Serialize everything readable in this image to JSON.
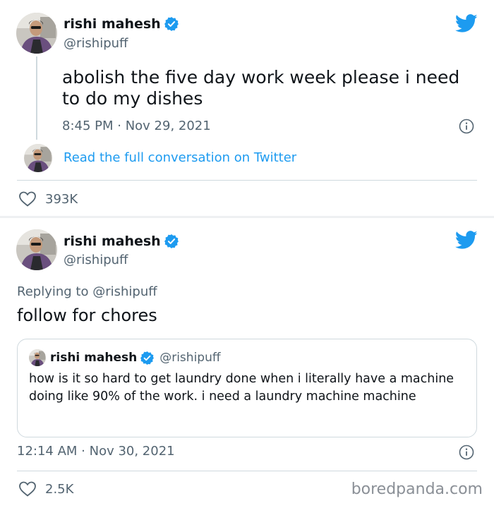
{
  "tweet1": {
    "author": {
      "name": "rishi mahesh",
      "handle": "@rishipuff"
    },
    "text": "abolish the five day work week please i need to do my dishes",
    "timestamp": "8:45 PM · Nov 29, 2021",
    "read_full": "Read the full conversation on Twitter",
    "likes": "393K"
  },
  "tweet2": {
    "author": {
      "name": "rishi mahesh",
      "handle": "@rishipuff"
    },
    "replying_to": "Replying to @rishipuff",
    "text": "follow for chores",
    "quote": {
      "name": "rishi mahesh",
      "handle": "@rishipuff",
      "text": "how is it so hard to get laundry done when i literally have a machine doing like 90% of the work. i need a laundry machine machine"
    },
    "timestamp": "12:14 AM · Nov 30, 2021",
    "likes": "2.5K"
  },
  "watermark": "boredpanda.com",
  "colors": {
    "twitter_blue": "#1d9bf0",
    "secondary_text": "#536471",
    "border": "#cfd9de"
  },
  "icons": [
    "twitter-bird-icon",
    "verified-badge-icon",
    "info-icon",
    "heart-icon"
  ]
}
